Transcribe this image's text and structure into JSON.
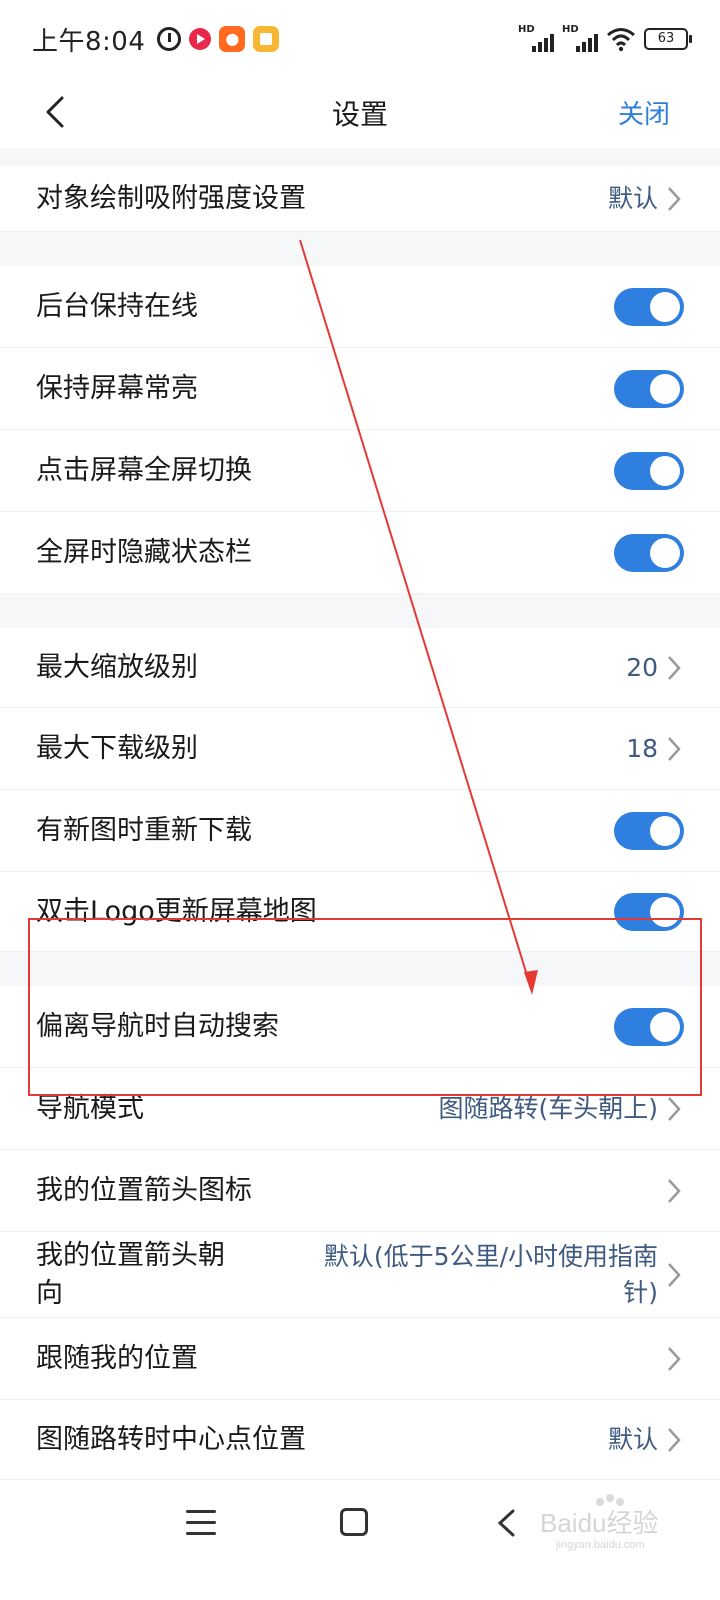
{
  "status_bar": {
    "time": "上午8:04",
    "battery": "63",
    "signal_label_1": "HD",
    "signal_label_2": "HD"
  },
  "header": {
    "title": "设置",
    "close_label": "关闭"
  },
  "rows": [
    {
      "label": "对象绘制吸附强度设置",
      "value": "默认",
      "type": "value"
    },
    {
      "label": "后台保持在线",
      "type": "toggle",
      "on": true
    },
    {
      "label": "保持屏幕常亮",
      "type": "toggle",
      "on": true
    },
    {
      "label": "点击屏幕全屏切换",
      "type": "toggle",
      "on": true
    },
    {
      "label": "全屏时隐藏状态栏",
      "type": "toggle",
      "on": true
    },
    {
      "label": "最大缩放级别",
      "value": "20",
      "type": "value"
    },
    {
      "label": "最大下载级别",
      "value": "18",
      "type": "value"
    },
    {
      "label": "有新图时重新下载",
      "type": "toggle",
      "on": true
    },
    {
      "label": "双击Logo更新屏幕地图",
      "type": "toggle",
      "on": true
    },
    {
      "label": "偏离导航时自动搜索",
      "type": "toggle",
      "on": true
    },
    {
      "label": "导航模式",
      "value": "图随路转(车头朝上)",
      "type": "value"
    },
    {
      "label": "我的位置箭头图标",
      "value": "",
      "type": "chevron"
    },
    {
      "label_line1": "我的位置箭头朝",
      "label_line2": "向",
      "value_line1": "默认(低于5公里/小时使用指南",
      "value_line2": "针)",
      "type": "value"
    },
    {
      "label": "跟随我的位置",
      "value": "",
      "type": "chevron"
    },
    {
      "label": "图随路转时中心点位置",
      "value": "默认",
      "type": "value"
    }
  ],
  "watermark": {
    "text": "Baidu经验",
    "sub": "jingyan.baidu.com"
  },
  "colors": {
    "accent": "#2f7fe0",
    "link": "#2f7fd9",
    "value_text": "#3f5a80",
    "annotation": "#e53935",
    "section_gap": "#f6f7f9"
  }
}
